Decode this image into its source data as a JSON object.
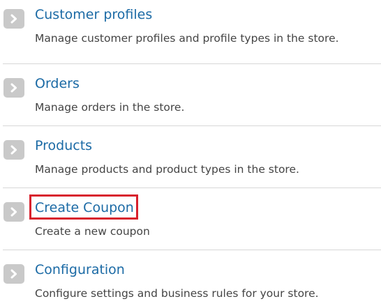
{
  "colors": {
    "link": "#1b6aa5",
    "description": "#444444",
    "arrow_badge": "#c9c9c9",
    "separator": "#d7d7d7",
    "highlight": "#d8202d"
  },
  "items": [
    {
      "title": "Customer profiles",
      "description": "Manage customer profiles and profile types in the store.",
      "icon": "chevron-right-icon"
    },
    {
      "title": "Orders",
      "description": "Manage orders in the store.",
      "icon": "chevron-right-icon"
    },
    {
      "title": "Products",
      "description": "Manage products and product types in the store.",
      "icon": "chevron-right-icon"
    },
    {
      "title": "Create Coupon",
      "description": "Create a new coupon",
      "icon": "chevron-right-icon",
      "highlighted": true
    },
    {
      "title": "Configuration",
      "description": "Configure settings and business rules for your store.",
      "icon": "chevron-right-icon"
    }
  ]
}
